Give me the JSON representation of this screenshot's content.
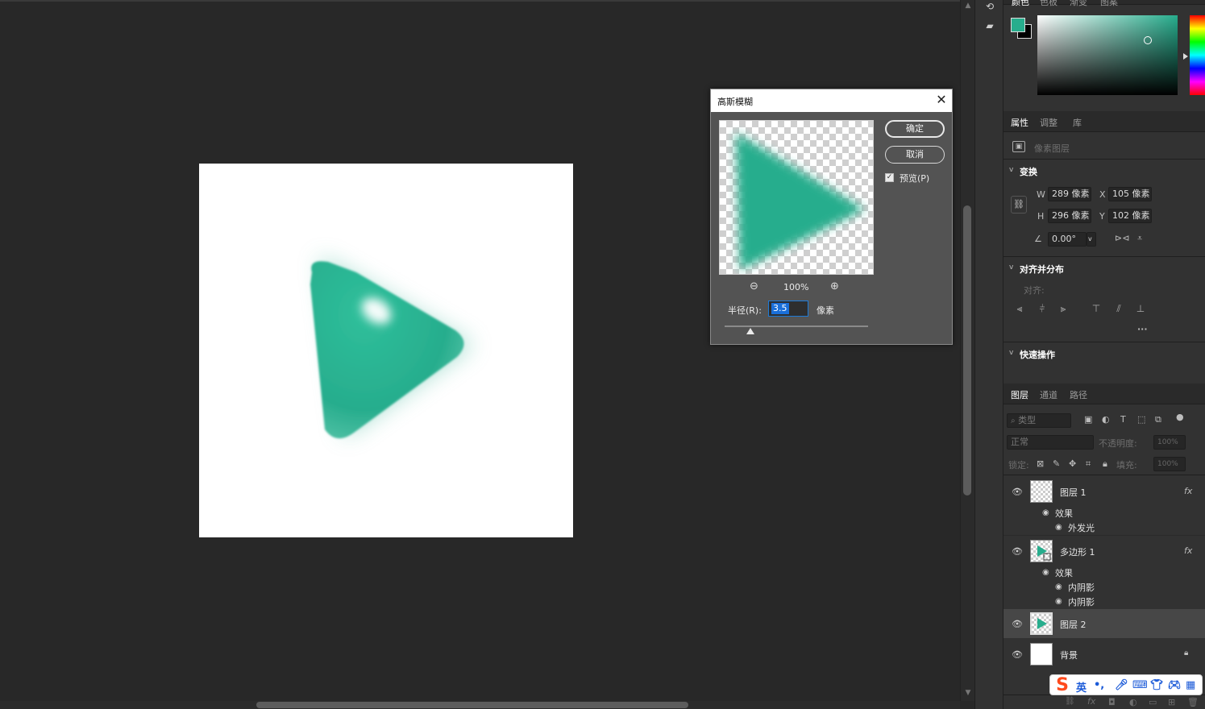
{
  "colors": {
    "accent_teal": "#27ad8d",
    "canvas_bg": "#282828",
    "panel_bg": "#323232"
  },
  "color_panel": {
    "tabs": [
      "颜色",
      "色板",
      "渐变",
      "图案"
    ]
  },
  "properties": {
    "tabs": [
      "属性",
      "调整",
      "库"
    ],
    "kind": "像素图层",
    "transform": {
      "title": "变换",
      "w_label": "W",
      "w": "289 像素",
      "x_label": "X",
      "x": "105 像素",
      "h_label": "H",
      "h": "296 像素",
      "y_label": "Y",
      "y": "102 像素",
      "angle": "0.00°"
    },
    "align": {
      "title": "对齐并分布",
      "label": "对齐:"
    },
    "quick": {
      "title": "快速操作"
    }
  },
  "layers_panel": {
    "tabs": [
      "图层",
      "通道",
      "路径"
    ],
    "search_placeholder": "类型",
    "blend_mode": "正常",
    "opacity_label": "不透明度:",
    "opacity": "100%",
    "lock_label": "锁定:",
    "fill_label": "填充:",
    "fill": "100%",
    "layers": [
      {
        "name": "图层 1",
        "fx": "fx",
        "effects_label": "效果",
        "effects": [
          "外发光"
        ]
      },
      {
        "name": "多边形 1",
        "fx": "fx",
        "effects_label": "效果",
        "effects": [
          "内阴影",
          "内阴影"
        ]
      },
      {
        "name": "图层 2"
      },
      {
        "name": "背景"
      }
    ]
  },
  "ime": {
    "lang": "英",
    "punct": "•,"
  },
  "dialog": {
    "title": "高斯模糊",
    "ok": "确定",
    "cancel": "取消",
    "preview_label": "预览(P)",
    "preview_checked": true,
    "zoom": "100%",
    "radius_label": "半径(R):",
    "radius_value": "3.5",
    "radius_unit": "像素",
    "slider_fraction": 0.18
  }
}
